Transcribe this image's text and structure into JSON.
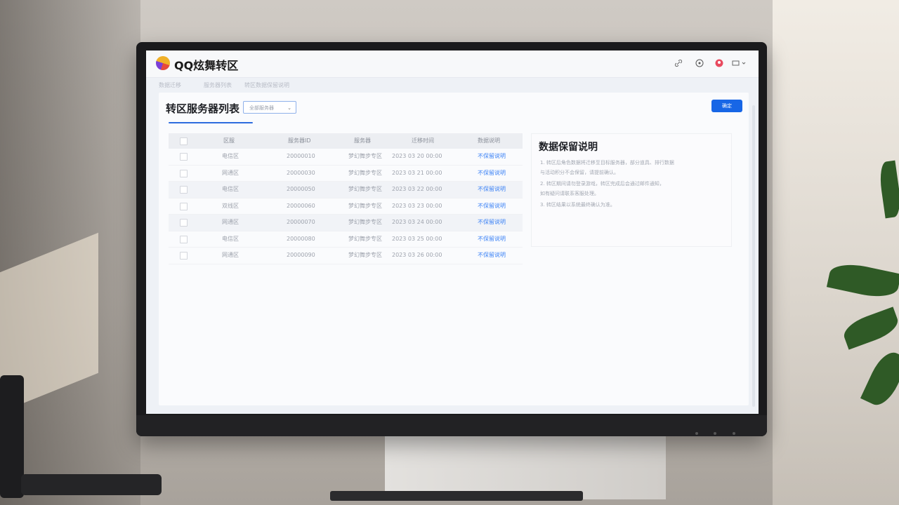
{
  "app": {
    "logo_text": "QQ炫舞转区"
  },
  "header_icons": [
    "link-icon",
    "help-icon",
    "avatar-icon",
    "menu-icon"
  ],
  "breadcrumbs": [
    "数据迁移",
    "服务器列表",
    "转区数据保留说明"
  ],
  "page": {
    "title": "转区服务器列表",
    "dropdown_value": "全部服务器",
    "primary_button": "确定"
  },
  "table": {
    "columns": [
      "区服",
      "服务器ID",
      "服务器",
      "迁移时间",
      "数据说明"
    ],
    "rows": [
      {
        "zone": "电信区",
        "id": "20000010",
        "server": "梦幻舞步专区",
        "time": "2023 03 20 00:00",
        "action": "不保留说明"
      },
      {
        "zone": "网通区",
        "id": "20000030",
        "server": "梦幻舞步专区",
        "time": "2023 03 21 00:00",
        "action": "不保留说明"
      },
      {
        "zone": "电信区",
        "id": "20000050",
        "server": "梦幻舞步专区",
        "time": "2023 03 22 00:00",
        "action": "不保留说明"
      },
      {
        "zone": "双线区",
        "id": "20000060",
        "server": "梦幻舞步专区",
        "time": "2023 03 23 00:00",
        "action": "不保留说明"
      },
      {
        "zone": "网通区",
        "id": "20000070",
        "server": "梦幻舞步专区",
        "time": "2023 03 24 00:00",
        "action": "不保留说明"
      },
      {
        "zone": "电信区",
        "id": "20000080",
        "server": "梦幻舞步专区",
        "time": "2023 03 25 00:00",
        "action": "不保留说明"
      },
      {
        "zone": "网通区",
        "id": "20000090",
        "server": "梦幻舞步专区",
        "time": "2023 03 26 00:00",
        "action": "不保留说明"
      }
    ]
  },
  "side_panel": {
    "title": "数据保留说明",
    "lines": [
      "1. 转区后角色数据将迁移至目标服务器，部分道具、排行数据",
      "   与活动积分不会保留，请提前确认。",
      "2. 转区期间请勿登录游戏，转区完成后会通过邮件通知，",
      "   如有疑问请联系客服处理。",
      "3. 转区结果以系统最终确认为准。"
    ]
  },
  "colors": {
    "accent": "#1766e6",
    "link": "#3b82f6"
  }
}
